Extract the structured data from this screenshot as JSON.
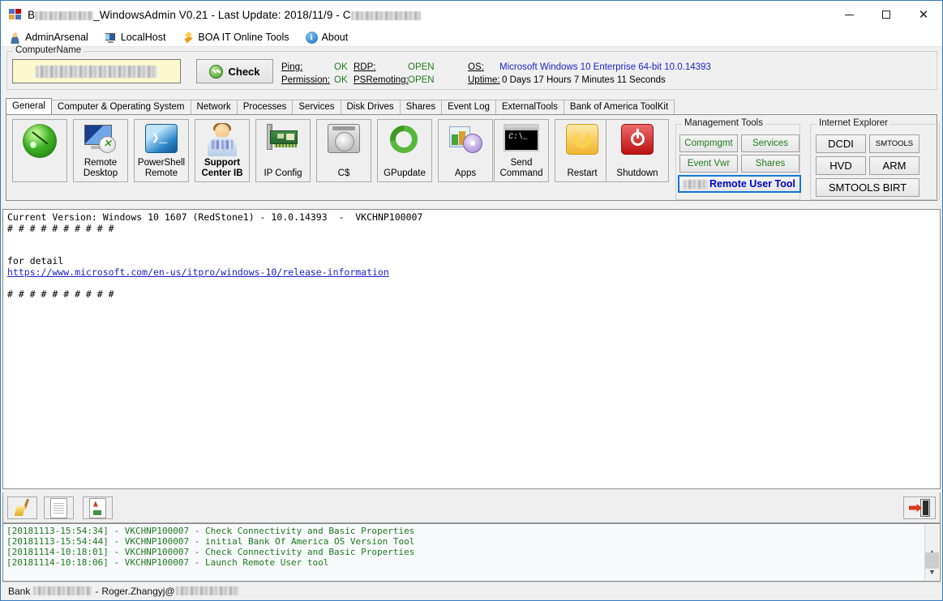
{
  "window": {
    "title_prefix": "B",
    "title_main": "_WindowsAdmin V0.21 - Last Update: 2018/11/9 - C",
    "minimize": "minimize",
    "maximize": "maximize",
    "close": "close"
  },
  "menu": [
    {
      "label": "AdminArsenal",
      "icon": "person-icon"
    },
    {
      "label": "LocalHost",
      "icon": "monitor-icon"
    },
    {
      "label": "BOA IT Online Tools",
      "icon": "flame-icon"
    },
    {
      "label": "About",
      "icon": "info-icon"
    }
  ],
  "computer_name": {
    "group_label": "ComputerName",
    "value": "",
    "check_label": "Check"
  },
  "status": {
    "ping_label": "Ping:",
    "ping_value": "OK",
    "permission_label": "Permission:",
    "permission_value": "OK",
    "rdp_label": "RDP:",
    "rdp_value": "OPEN",
    "psremoting_label": "PSRemoting:",
    "psremoting_value": "OPEN",
    "os_label": "OS:",
    "os_value": "Microsoft Windows 10 Enterprise 64-bit 10.0.14393",
    "uptime_label": "Uptime:",
    "uptime_value": "0 Days 17 Hours 7 Minutes 11 Seconds"
  },
  "tabs": [
    {
      "label": "General",
      "active": true
    },
    {
      "label": "Computer & Operating System",
      "active": false
    },
    {
      "label": "Network",
      "active": false
    },
    {
      "label": "Processes",
      "active": false
    },
    {
      "label": "Services",
      "active": false
    },
    {
      "label": "Disk Drives",
      "active": false
    },
    {
      "label": "Shares",
      "active": false
    },
    {
      "label": "Event Log",
      "active": false
    },
    {
      "label": "ExternalTools",
      "active": false
    },
    {
      "label": "Bank of America ToolKit",
      "active": false
    }
  ],
  "toolbuttons": [
    {
      "label": "Ping",
      "icon": "ping-radar-icon"
    },
    {
      "label": "Remote\nDesktop",
      "line1": "Remote",
      "line2": "Desktop",
      "icon": "remote-desktop-icon"
    },
    {
      "label": "PowerShell Remote",
      "line1": "PowerShell",
      "line2": "Remote",
      "icon": "powershell-icon"
    },
    {
      "label": "Support Center IB",
      "line1": "Support",
      "line2": "Center IB",
      "icon": "support-person-icon"
    },
    {
      "label": "IP Config",
      "line1": "IP Config",
      "line2": "",
      "icon": "network-card-icon"
    },
    {
      "label": "C$",
      "line1": "C$",
      "line2": "",
      "icon": "hard-disk-icon"
    },
    {
      "label": "GPupdate",
      "line1": "GPupdate",
      "line2": "",
      "icon": "refresh-arrows-icon"
    },
    {
      "label": "Apps",
      "line1": "Apps",
      "line2": "",
      "icon": "apps-cd-icon"
    },
    {
      "label": "Send Command",
      "line1": "Send",
      "line2": "Command",
      "icon": "console-icon"
    },
    {
      "label": "Restart",
      "line1": "Restart",
      "line2": "",
      "icon": "restart-icon"
    },
    {
      "label": "Shutdown",
      "line1": "Shutdown",
      "line2": "",
      "icon": "power-icon"
    }
  ],
  "management_tools": {
    "group_label": "Management Tools",
    "buttons": [
      "Compmgmt",
      "Services",
      "Event Vwr",
      "Shares"
    ],
    "remote_user_tool": "Remote User Tool"
  },
  "internet_explorer": {
    "group_label": "Internet Explorer",
    "buttons": [
      "DCDI",
      "SMTOOLS",
      "HVD",
      "ARM",
      "SMTOOLS BIRT"
    ]
  },
  "output": {
    "line1": "Current Version: Windows 10 1607 (RedStone1) - 10.0.14393  -  VKCHNP100007",
    "line2": "# # # # # # # # # #",
    "line3": "",
    "line4": "",
    "line5": "for detail",
    "link": "https://www.microsoft.com/en-us/itpro/windows-10/release-information",
    "line7": "",
    "line8": "# # # # # # # # # #"
  },
  "bottom_toolbar": {
    "clear_label": "clear",
    "copy_label": "copy",
    "report_label": "report",
    "exit_label": "exit"
  },
  "log": {
    "lines": [
      "[20181113-15:54:34] - VKCHNP100007 - Check Connectivity and Basic Properties",
      "[20181113-15:54:44] - VKCHNP100007 - initial Bank Of America OS Version Tool",
      "[20181114-10:18:01] - VKCHNP100007 - Check Connectivity and Basic Properties",
      "[20181114-10:18:06] - VKCHNP100007 - Launch Remote User tool"
    ]
  },
  "statusbar": {
    "prefix": "Bank",
    "separator": "-",
    "user": "Roger.Zhangyj@"
  },
  "colors": {
    "accent": "#1577d4",
    "ok": "#1f7a1f",
    "link": "#2222cc",
    "title_border": "#3a7abd",
    "input_bg": "#fbf8cd"
  }
}
